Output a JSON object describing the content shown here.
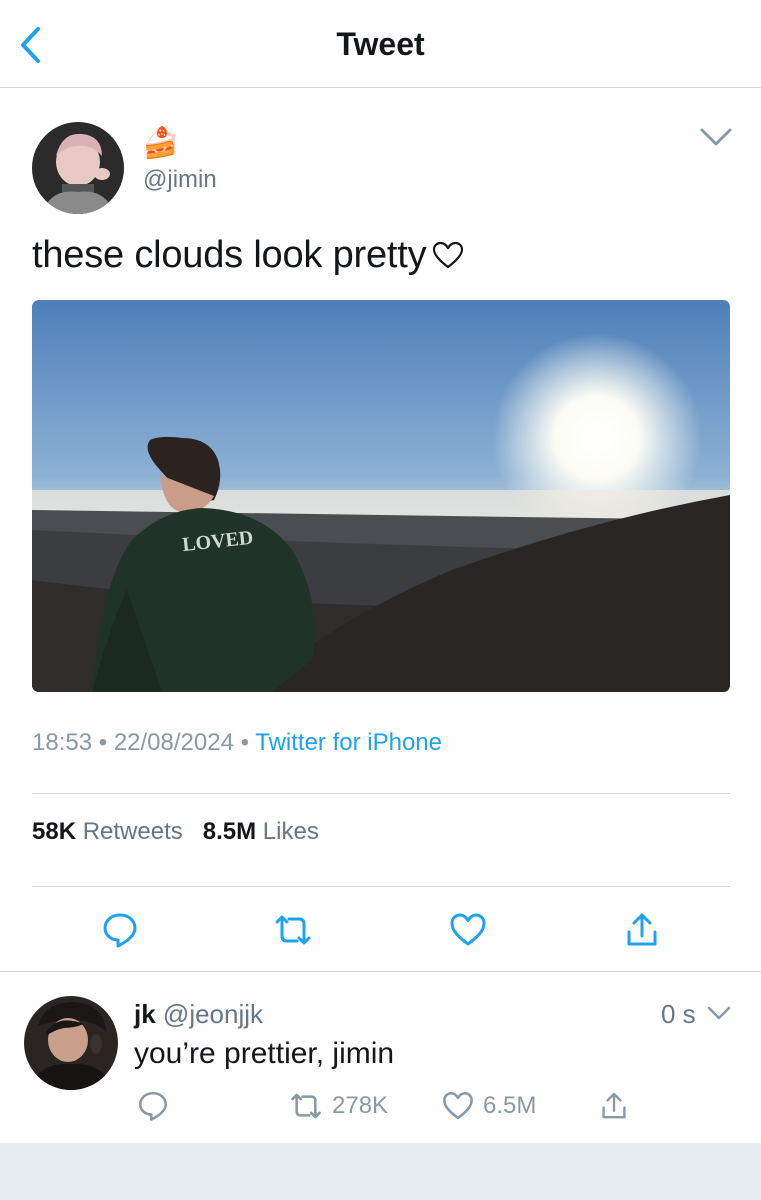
{
  "header": {
    "title": "Tweet",
    "back_icon": "chevron-left-icon"
  },
  "tweet": {
    "display_name_emoji": "🍰",
    "handle": "@jimin",
    "text": "these clouds look pretty",
    "photo_overlay_text": "LOVED",
    "meta": {
      "time": "18:53",
      "separator": "•",
      "date": "22/08/2024",
      "source": "Twitter for iPhone"
    },
    "stats": {
      "retweets_count": "58K",
      "retweets_label": "Retweets",
      "likes_count": "8.5M",
      "likes_label": "Likes"
    },
    "actions": [
      "reply-icon",
      "retweet-icon",
      "like-icon",
      "share-icon"
    ]
  },
  "reply": {
    "name": "jk",
    "handle": "@jeonjjk",
    "time": "0 s",
    "text": "you’re prettier, jimin",
    "retweets": "278K",
    "likes": "6.5M"
  },
  "colors": {
    "accent": "#1da1f2",
    "muted": "#657786",
    "divider": "#d6d9dc",
    "footer": "#e6ecf0"
  }
}
